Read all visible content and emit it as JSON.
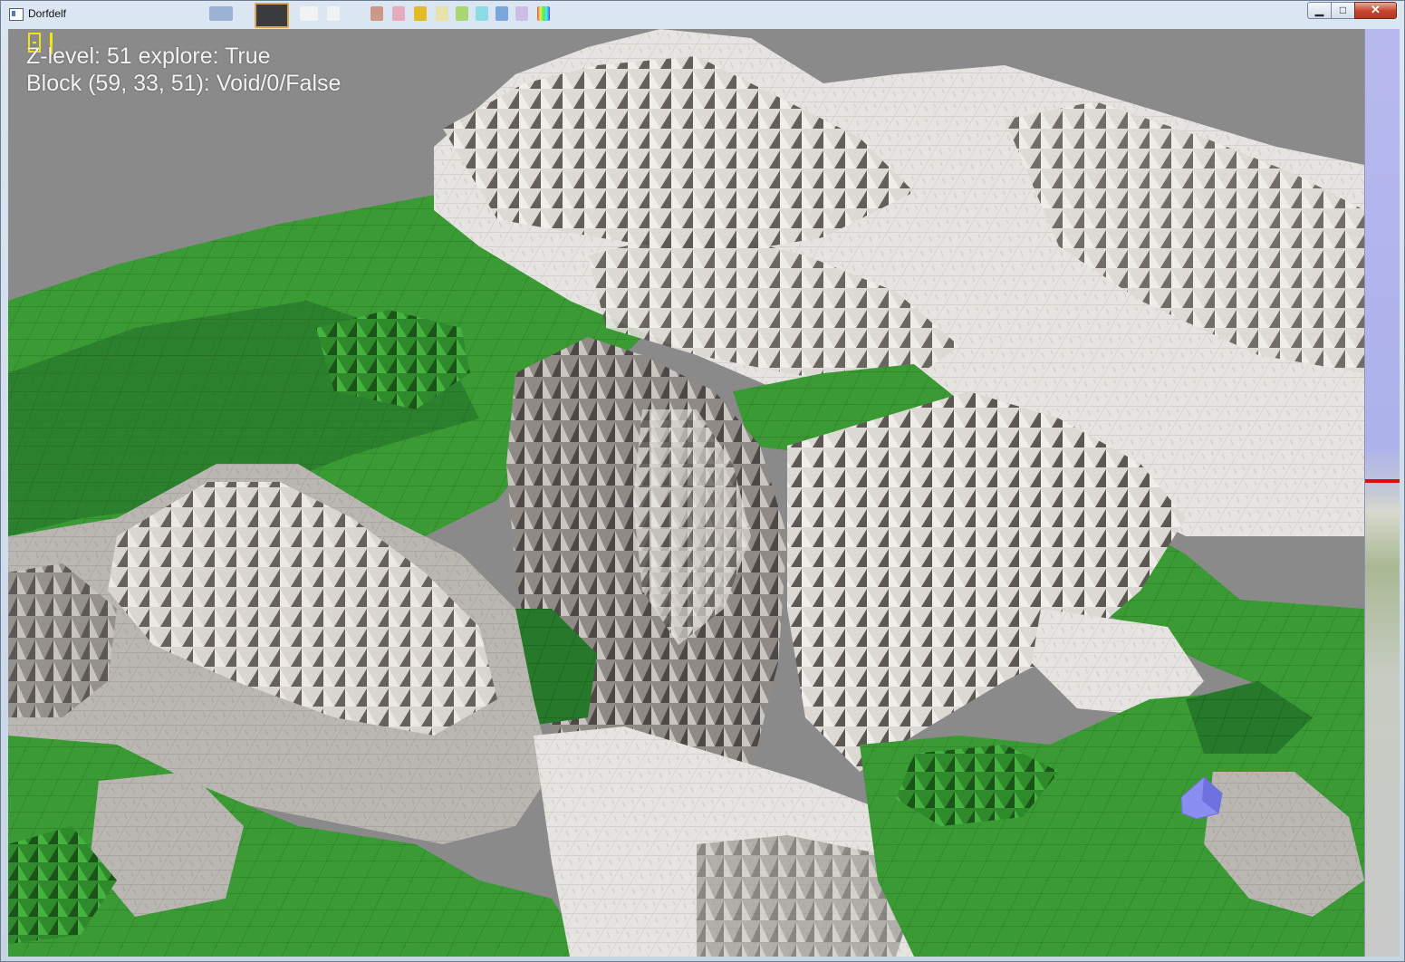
{
  "window": {
    "title": "Dorfdelf",
    "minimize_glyph": "▁",
    "maximize_glyph": "□",
    "close_glyph": "✕"
  },
  "hud": {
    "fps_text": "8 |",
    "zlevel_line": "Z-level: 51  explore: True",
    "block_line": "Block (59, 33, 51): Void/0/False"
  },
  "zbar": {
    "current_level_fraction": 0.485,
    "marker_color": "#e20c0c"
  },
  "colors": {
    "sky": "#8a8a8a",
    "grass": "#3a9a34",
    "grass_dark": "#1f6a1e",
    "stone_light": "#e6e4e0",
    "stone_mid": "#bdbab6",
    "stone_dark": "#6e6966",
    "water": "#8a8ef0"
  },
  "icons": {
    "app": "window-app-icon"
  }
}
